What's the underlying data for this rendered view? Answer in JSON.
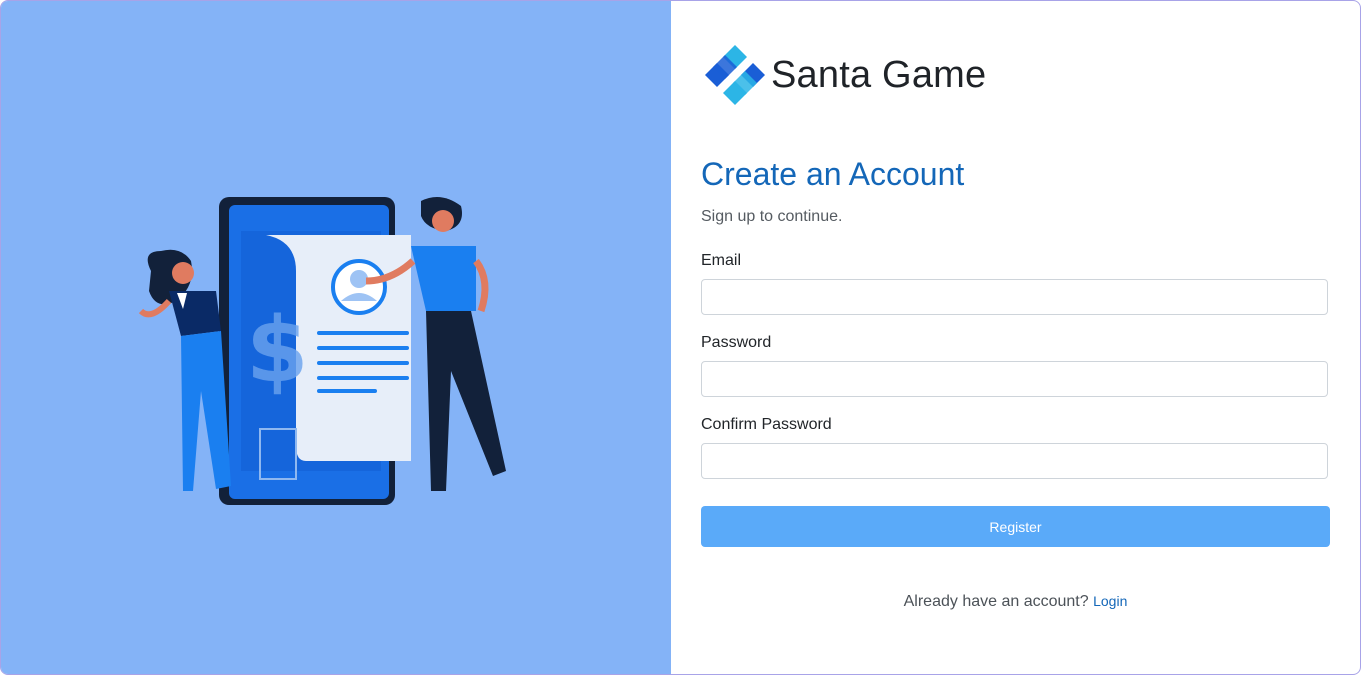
{
  "brand": {
    "name": "Santa Game",
    "logo_icon": "diamond-logo-icon",
    "logo_colors": [
      "#1a5ed6",
      "#2cb5e6"
    ]
  },
  "form": {
    "title": "Create an Account",
    "subtitle": "Sign up to continue.",
    "email_label": "Email",
    "email_value": "",
    "password_label": "Password",
    "password_value": "",
    "confirm_label": "Confirm Password",
    "confirm_value": "",
    "register_label": "Register"
  },
  "footer": {
    "prompt": "Already have an account?",
    "login_label": "Login"
  },
  "colors": {
    "left_panel_bg": "#84b3f7",
    "title": "#1467b8",
    "button_bg": "#5aaaf9",
    "link": "#1467b8"
  },
  "illustration": {
    "icon": "signup-illustration-icon"
  }
}
